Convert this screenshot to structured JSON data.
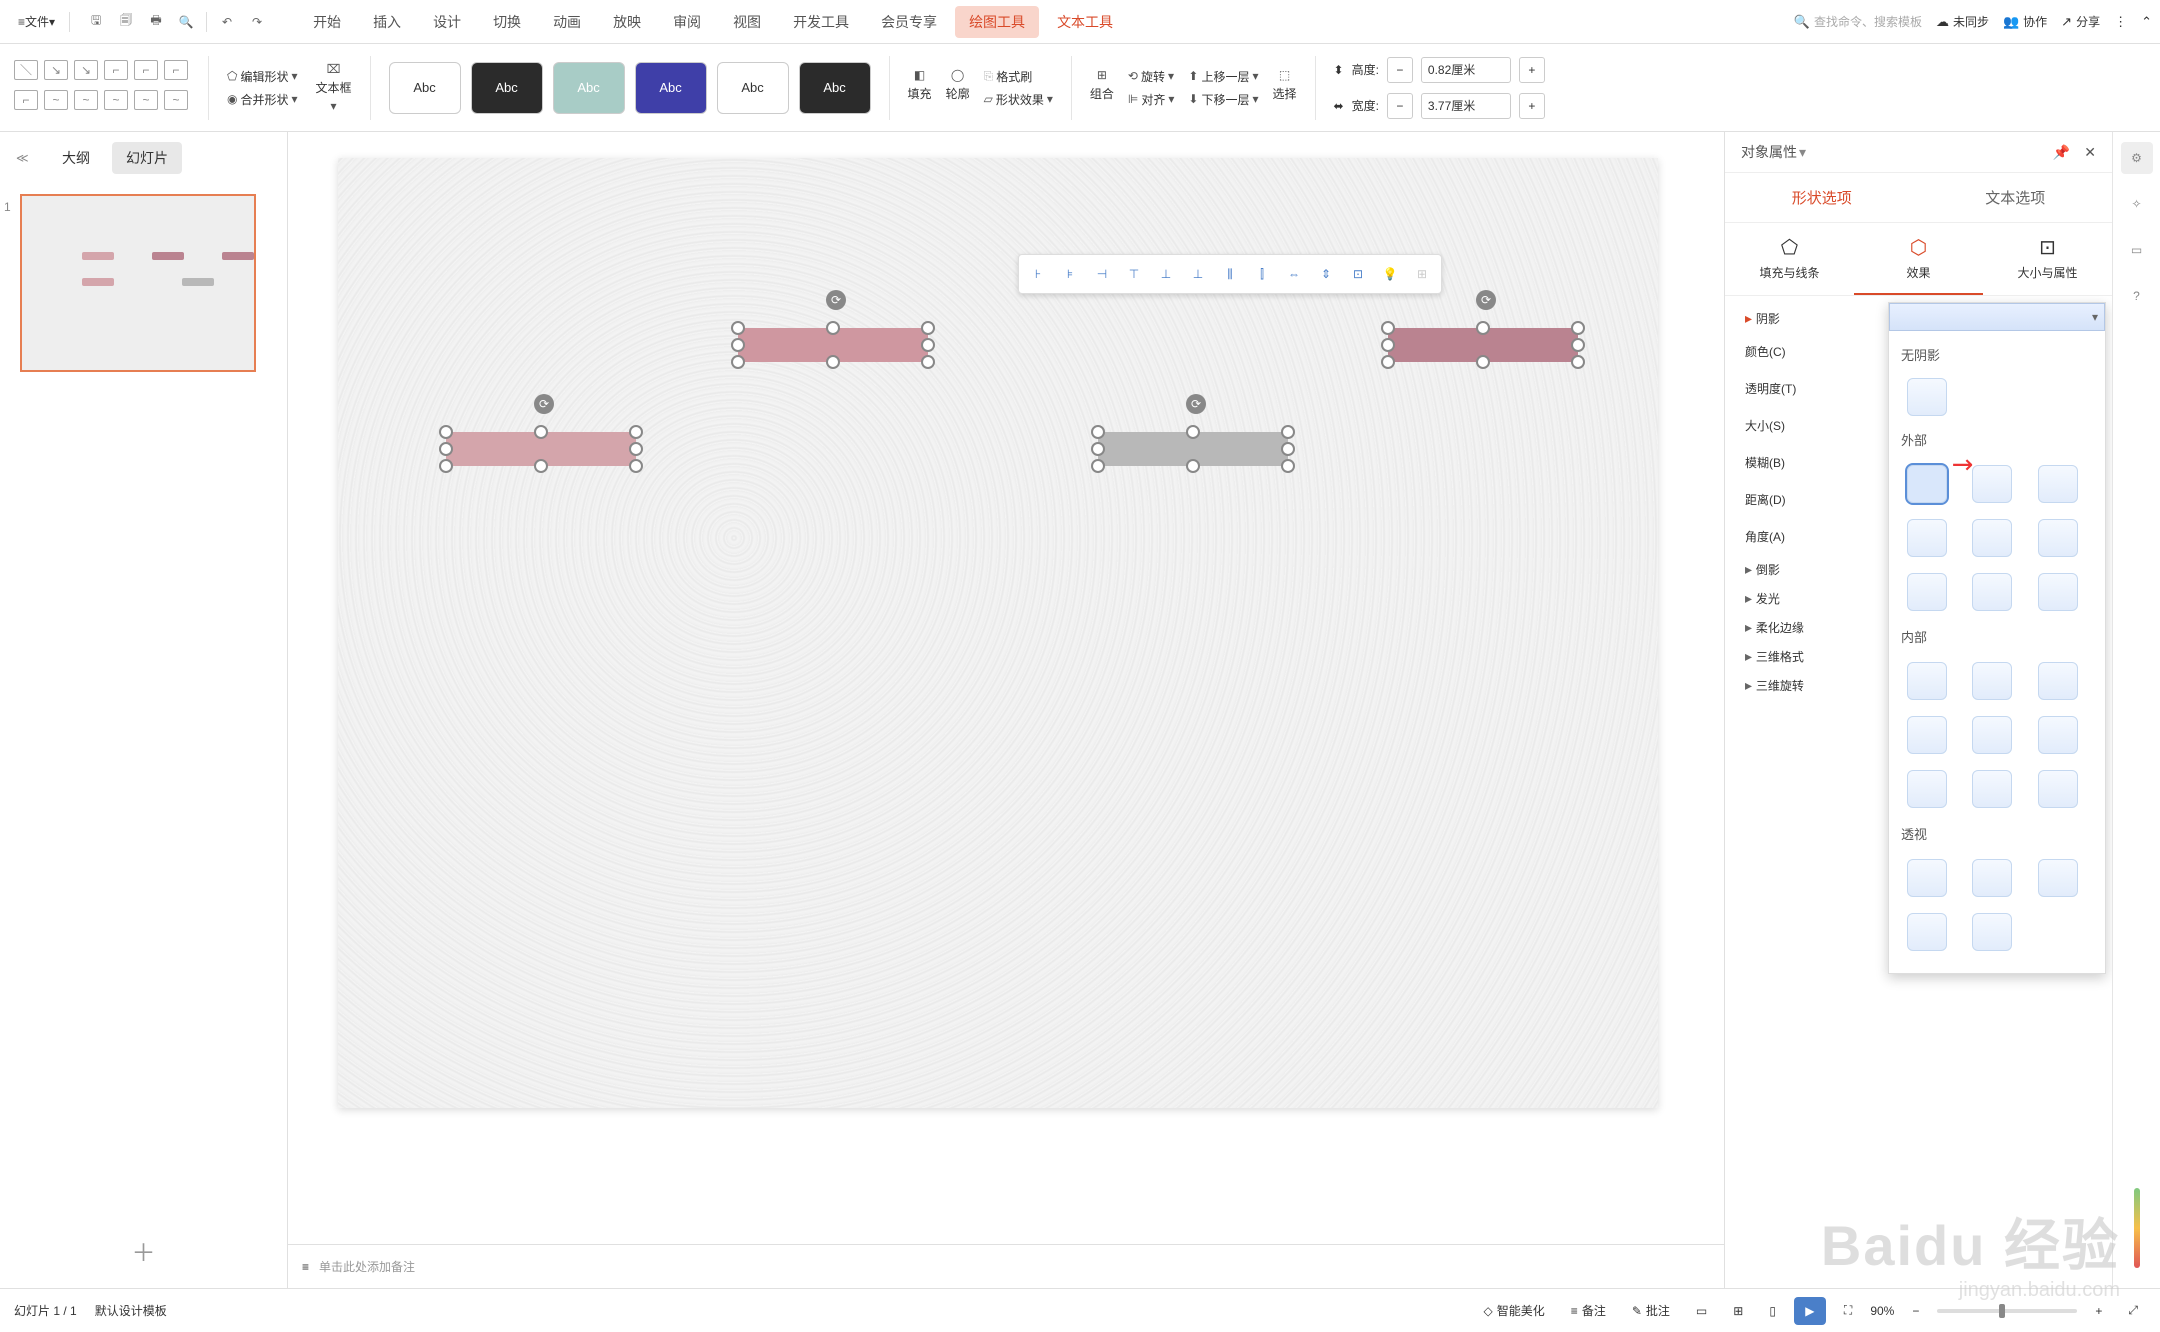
{
  "menu": {
    "file": "文件",
    "dd": "▾"
  },
  "tabs": [
    "开始",
    "插入",
    "设计",
    "切换",
    "动画",
    "放映",
    "审阅",
    "视图",
    "开发工具",
    "会员专享"
  ],
  "context_tabs": {
    "draw": "绘图工具",
    "text": "文本工具"
  },
  "search": {
    "placeholder": "查找命令、搜索模板"
  },
  "top_right": {
    "unsync": "未同步",
    "collab": "协作",
    "share": "分享"
  },
  "ribbon": {
    "edit_shape": "编辑形状",
    "merge_shape": "合并形状",
    "textbox": "文本框",
    "fill": "填充",
    "outline": "轮廓",
    "shape_fx": "形状效果",
    "group": "组合",
    "rotate": "旋转",
    "align": "对齐",
    "bring_fwd": "上移一层",
    "send_back": "下移一层",
    "select": "选择",
    "fmt_painter": "格式刷",
    "height": "高度:",
    "width": "宽度:",
    "h_val": "0.82厘米",
    "w_val": "3.77厘米",
    "abc": "Abc"
  },
  "left": {
    "outline": "大纲",
    "slides": "幻灯片",
    "n1": "1"
  },
  "right": {
    "title": "对象属性",
    "shape_opt": "形状选项",
    "text_opt": "文本选项",
    "fill_line": "填充与线条",
    "effects": "效果",
    "size_prop": "大小与属性",
    "shadow": "阴影",
    "color": "颜色(C)",
    "transparency": "透明度(T)",
    "size": "大小(S)",
    "blur": "模糊(B)",
    "distance": "距离(D)",
    "angle": "角度(A)",
    "reflection": "倒影",
    "glow": "发光",
    "soft_edge": "柔化边缘",
    "threed_fmt": "三维格式",
    "threed_rot": "三维旋转",
    "no_shadow": "无阴影",
    "outer": "外部",
    "inner": "内部",
    "perspective": "透视"
  },
  "notes": "单击此处添加备注",
  "status": {
    "slide": "幻灯片 1 / 1",
    "template": "默认设计模板",
    "beautify": "智能美化",
    "notes_btn": "备注",
    "comment": "批注",
    "zoom": "90%"
  },
  "wm": {
    "main": "Baidu 经验",
    "sub": "jingyan.baidu.com"
  }
}
